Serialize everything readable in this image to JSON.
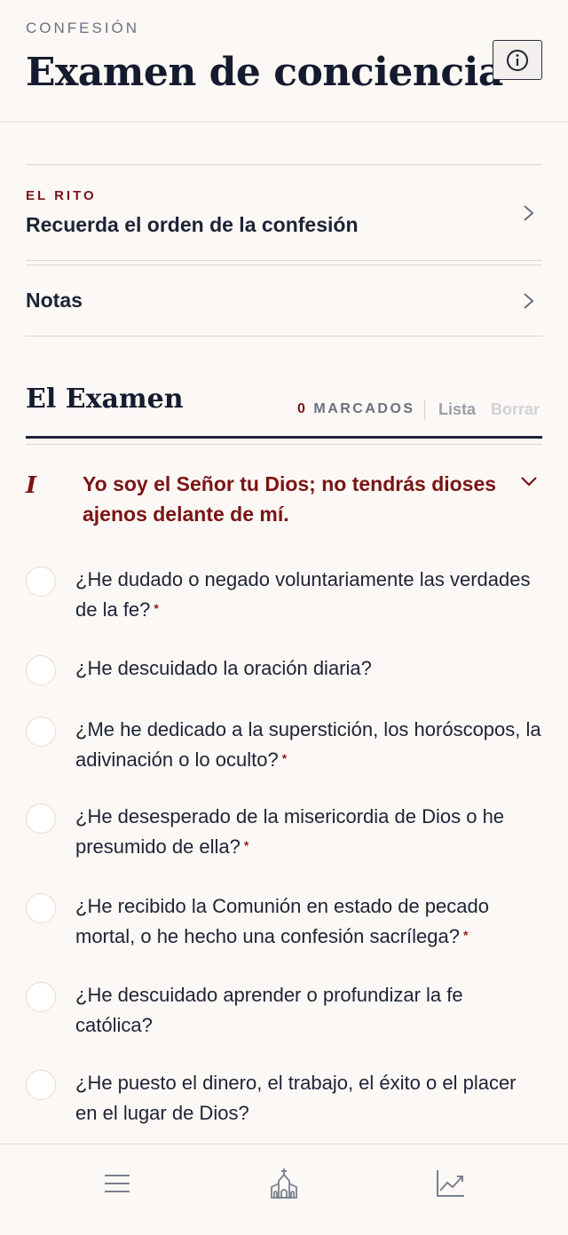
{
  "header": {
    "eyebrow": "CONFESIÓN",
    "title": "Examen de conciencia",
    "info_icon": "info-circle-icon"
  },
  "rito": {
    "eyebrow": "EL RITO",
    "label": "Recuerda el orden de la confesión"
  },
  "notas": {
    "label": "Notas"
  },
  "examen": {
    "title": "El Examen",
    "marked_count": "0",
    "marked_label": "MARCADOS",
    "lista_label": "Lista",
    "borrar_label": "Borrar"
  },
  "commandment": {
    "numeral": "I",
    "text": "Yo soy el Señor tu Dios; no tendrás dioses ajenos delante de mí."
  },
  "questions": [
    {
      "text": "¿He dudado o negado voluntariamente las verdades de la fe?",
      "grave": true,
      "marker": "*"
    },
    {
      "text": "¿He descuidado la oración diaria?",
      "grave": false,
      "marker": ""
    },
    {
      "text": "¿Me he dedicado a la superstición, los horóscopos, la adivinación o lo oculto?",
      "grave": true,
      "marker": "*"
    },
    {
      "text": "¿He desesperado de la misericordia de Dios o he presumido de ella?",
      "grave": true,
      "marker": "*"
    },
    {
      "text": "¿He recibido la Comunión en estado de pecado mortal, o he hecho una confesión sacrílega?",
      "grave": true,
      "marker": "*"
    },
    {
      "text": "¿He descuidado aprender o profundizar la fe católica?",
      "grave": false,
      "marker": ""
    },
    {
      "text": "¿He puesto el dinero, el trabajo, el éxito o el placer en el lugar de Dios?",
      "grave": false,
      "marker": ""
    }
  ],
  "tabbar": {
    "tabs": [
      {
        "icon": "menu-icon"
      },
      {
        "icon": "church-icon"
      },
      {
        "icon": "chart-icon"
      }
    ]
  },
  "colors": {
    "accent": "#7a1414",
    "ink": "#1d2336",
    "background": "#fcf8f5"
  }
}
